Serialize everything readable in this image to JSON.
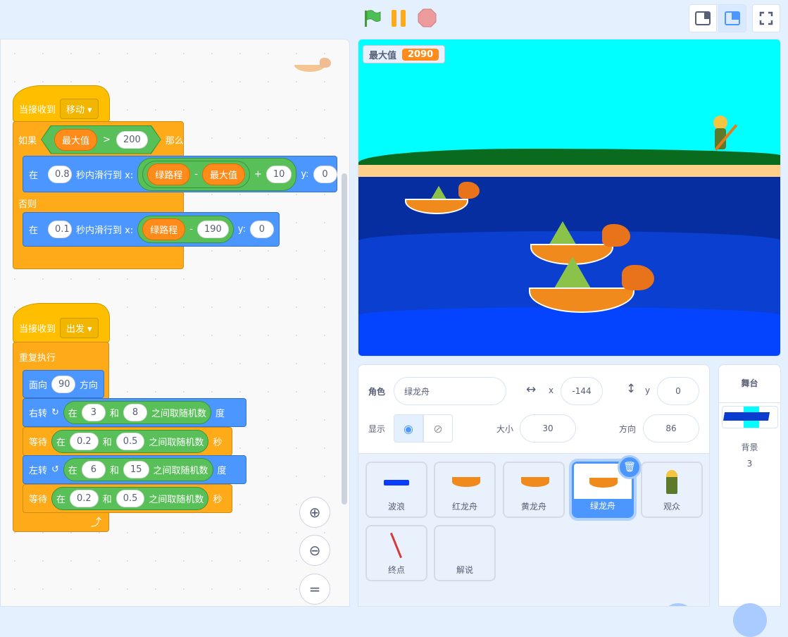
{
  "toolbar": {
    "green_flag": "green-flag-icon",
    "pause": "pause-icon",
    "stop": "stop-icon"
  },
  "scripts": {
    "script1": {
      "hat": "当接收到",
      "message": "移动",
      "if": "如果",
      "var_max": "最大值",
      "gt": ">",
      "threshold": "200",
      "then": "那么",
      "glide1": {
        "at": "在",
        "secs": "0.8",
        "text": "秒内滑行到 x:",
        "var_a": "绿路程",
        "minus": "-",
        "var_b": "最大值",
        "plus": "+",
        "add": "10",
        "y_label": "y:",
        "y": "0"
      },
      "else": "否则",
      "glide2": {
        "at": "在",
        "secs": "0.1",
        "text": "秒内滑行到 x:",
        "var_a": "绿路程",
        "minus": "-",
        "sub": "190",
        "y_label": "y:",
        "y": "0"
      }
    },
    "script2": {
      "hat": "当接收到",
      "message": "出发",
      "forever": "重复执行",
      "point": {
        "label": "面向",
        "value": "90",
        "suffix": "方向"
      },
      "turn_right": {
        "label": "右转",
        "at": "在",
        "a": "3",
        "and": "和",
        "b": "8",
        "rand": "之间取随机数",
        "unit": "度"
      },
      "wait1": {
        "label": "等待",
        "at": "在",
        "a": "0.2",
        "and": "和",
        "b": "0.5",
        "rand": "之间取随机数",
        "unit": "秒"
      },
      "turn_left": {
        "label": "左转",
        "at": "在",
        "a": "6",
        "and": "和",
        "b": "15",
        "rand": "之间取随机数",
        "unit": "度"
      },
      "wait2": {
        "label": "等待",
        "at": "在",
        "a": "0.2",
        "and": "和",
        "b": "0.5",
        "rand": "之间取随机数",
        "unit": "秒"
      }
    }
  },
  "monitor": {
    "label": "最大值",
    "value": "2090"
  },
  "sprite_info": {
    "sprite_label": "角色",
    "sprite_name": "绿龙舟",
    "x_label": "x",
    "x": "-144",
    "y_label": "y",
    "y": "0",
    "show_label": "显示",
    "size_label": "大小",
    "size": "30",
    "direction_label": "方向",
    "direction": "86"
  },
  "sprites": [
    {
      "name": "波浪"
    },
    {
      "name": "红龙舟"
    },
    {
      "name": "黄龙舟"
    },
    {
      "name": "绿龙舟",
      "selected": true
    },
    {
      "name": "观众"
    },
    {
      "name": "终点"
    },
    {
      "name": "解说"
    }
  ],
  "stage_panel": {
    "title": "舞台",
    "backdrops_label": "背景",
    "backdrops_count": "3"
  },
  "colors": {
    "events": "#ffbf00",
    "control": "#ffab19",
    "motion": "#4c97ff",
    "operators": "#59c059",
    "variables": "#ff8c1a",
    "accent": "#4c97ff"
  }
}
